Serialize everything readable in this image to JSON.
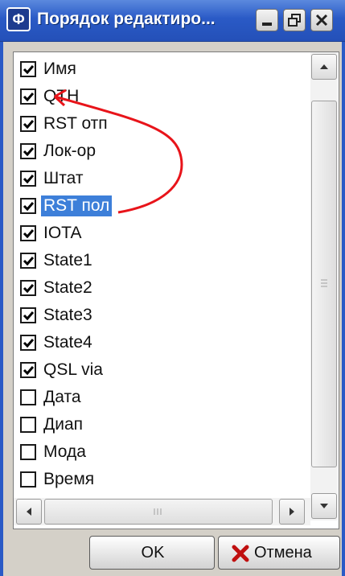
{
  "window": {
    "title": "Порядок редактиро...",
    "icon_glyph": "Ф"
  },
  "titlebar_buttons": [
    "minimize-icon",
    "restore-icon",
    "close-icon"
  ],
  "columns": [
    {
      "label": "Имя",
      "checked": true,
      "selected": false
    },
    {
      "label": "QTH",
      "checked": true,
      "selected": false
    },
    {
      "label": "RST отп",
      "checked": true,
      "selected": false
    },
    {
      "label": "Лок-ор",
      "checked": true,
      "selected": false
    },
    {
      "label": "Штат",
      "checked": true,
      "selected": false
    },
    {
      "label": "RST пол",
      "checked": true,
      "selected": true
    },
    {
      "label": "IOTA",
      "checked": true,
      "selected": false
    },
    {
      "label": "State1",
      "checked": true,
      "selected": false
    },
    {
      "label": "State2",
      "checked": true,
      "selected": false
    },
    {
      "label": "State3",
      "checked": true,
      "selected": false
    },
    {
      "label": "State4",
      "checked": true,
      "selected": false
    },
    {
      "label": "QSL via",
      "checked": true,
      "selected": false
    },
    {
      "label": "Дата",
      "checked": false,
      "selected": false
    },
    {
      "label": "Диап",
      "checked": false,
      "selected": false
    },
    {
      "label": "Мода",
      "checked": false,
      "selected": false
    },
    {
      "label": "Время",
      "checked": false,
      "selected": false
    }
  ],
  "annotation": {
    "color": "#e8141a",
    "shape": "curved-arrow-pointing-up"
  },
  "buttons": {
    "ok_label": "OK",
    "cancel_label": "Отмена",
    "cancel_icon": "x-icon",
    "cancel_icon_color": "#c01010"
  },
  "colors": {
    "titlebar": "#2a5ac6",
    "selection": "#3d7fd9"
  }
}
